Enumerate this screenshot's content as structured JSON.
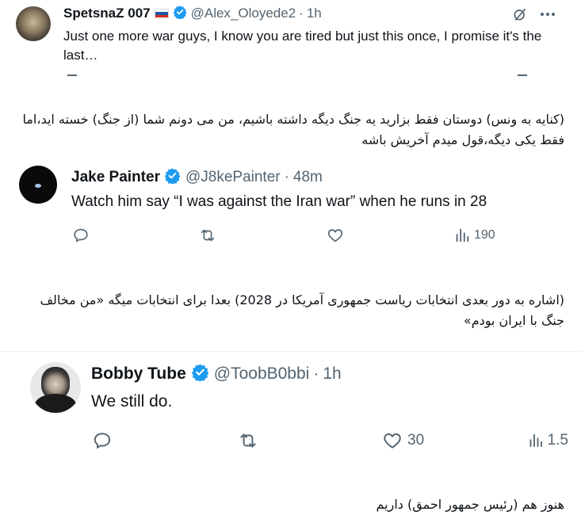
{
  "tweet1": {
    "name": "SpetsnaZ 007",
    "handle": "@Alex_Oloyede2",
    "time": "1h",
    "text": "Just one more war guys, I know you are tired but just this once, I promise it's the last…"
  },
  "caption1": "(کنایه به ونس) دوستان فقط بزارید یه جنگ دیگه داشته باشیم، من می دونم شما (از جنگ) خسته اید،اما فقط یکی دیگه،قول میدم آخریش باشه",
  "tweet2": {
    "name": "Jake Painter",
    "handle": "@J8kePainter",
    "time": "48m",
    "text": "Watch him say “I was against the Iran war” when he runs in 28",
    "views": "190"
  },
  "caption2": "(اشاره به دور بعدی انتخابات ریاست جمهوری آمریکا در 2028) بعدا برای انتخابات میگه «من مخالف جنگ با ایران بودم»",
  "tweet3": {
    "name": "Bobby Tube",
    "handle": "@ToobB0bbi",
    "time": "1h",
    "text": "We still do.",
    "likes": "30",
    "views": "1.5"
  },
  "caption3": "هنوز هم (رئیس جمهور احمق) داریم",
  "colors": {
    "verified": "#1d9bf0",
    "muted": "#536471",
    "text": "#0f1419"
  }
}
